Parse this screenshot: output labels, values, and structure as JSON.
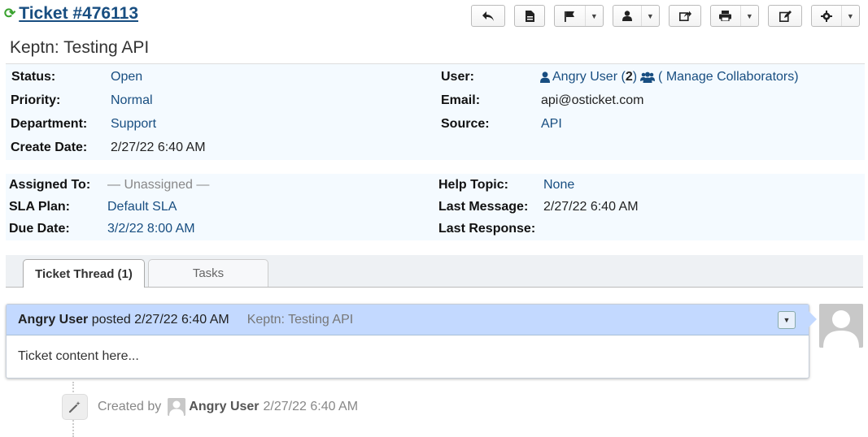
{
  "header": {
    "ticket_title": "Ticket #476113",
    "subject": "Keptn: Testing API"
  },
  "toolbar": {
    "buttons": [
      "reply-icon",
      "print-page-icon",
      "flag-icon",
      "user-icon",
      "transfer-icon",
      "printer-icon",
      "edit-icon",
      "gear-icon"
    ]
  },
  "info": {
    "status_label": "Status:",
    "status": "Open",
    "priority_label": "Priority:",
    "priority": "Normal",
    "department_label": "Department:",
    "department": "Support",
    "create_date_label": "Create Date:",
    "create_date": "2/27/22 6:40 AM",
    "user_label": "User:",
    "user_name": "Angry User",
    "user_count_open": " (",
    "user_count": "2",
    "user_count_close": ")",
    "manage_collaborators": "( Manage Collaborators)",
    "email_label": "Email:",
    "email": "api@osticket.com",
    "source_label": "Source:",
    "source": "API"
  },
  "assign": {
    "assigned_to_label": "Assigned To:",
    "assigned_to": "— Unassigned —",
    "sla_plan_label": "SLA Plan:",
    "sla_plan": "Default SLA",
    "due_date_label": "Due Date:",
    "due_date": "3/2/22 8:00 AM",
    "help_topic_label": "Help Topic:",
    "help_topic": "None",
    "last_message_label": "Last Message:",
    "last_message": "2/27/22 6:40 AM",
    "last_response_label": "Last Response:"
  },
  "tabs": {
    "thread": "Ticket Thread (1)",
    "tasks": "Tasks"
  },
  "thread": {
    "author": "Angry User",
    "posted": " posted 2/27/22 6:40 AM",
    "subject": "Keptn: Testing API",
    "body": "Ticket content here..."
  },
  "event": {
    "created_by": "Created by",
    "user": "Angry User",
    "date": "2/27/22 6:40 AM"
  },
  "colors": {
    "link": "#184E81",
    "info_bg": "#F4FAFF",
    "thread_header_bg": "#C3D9FF",
    "refresh_icon": "#3aa22f"
  }
}
